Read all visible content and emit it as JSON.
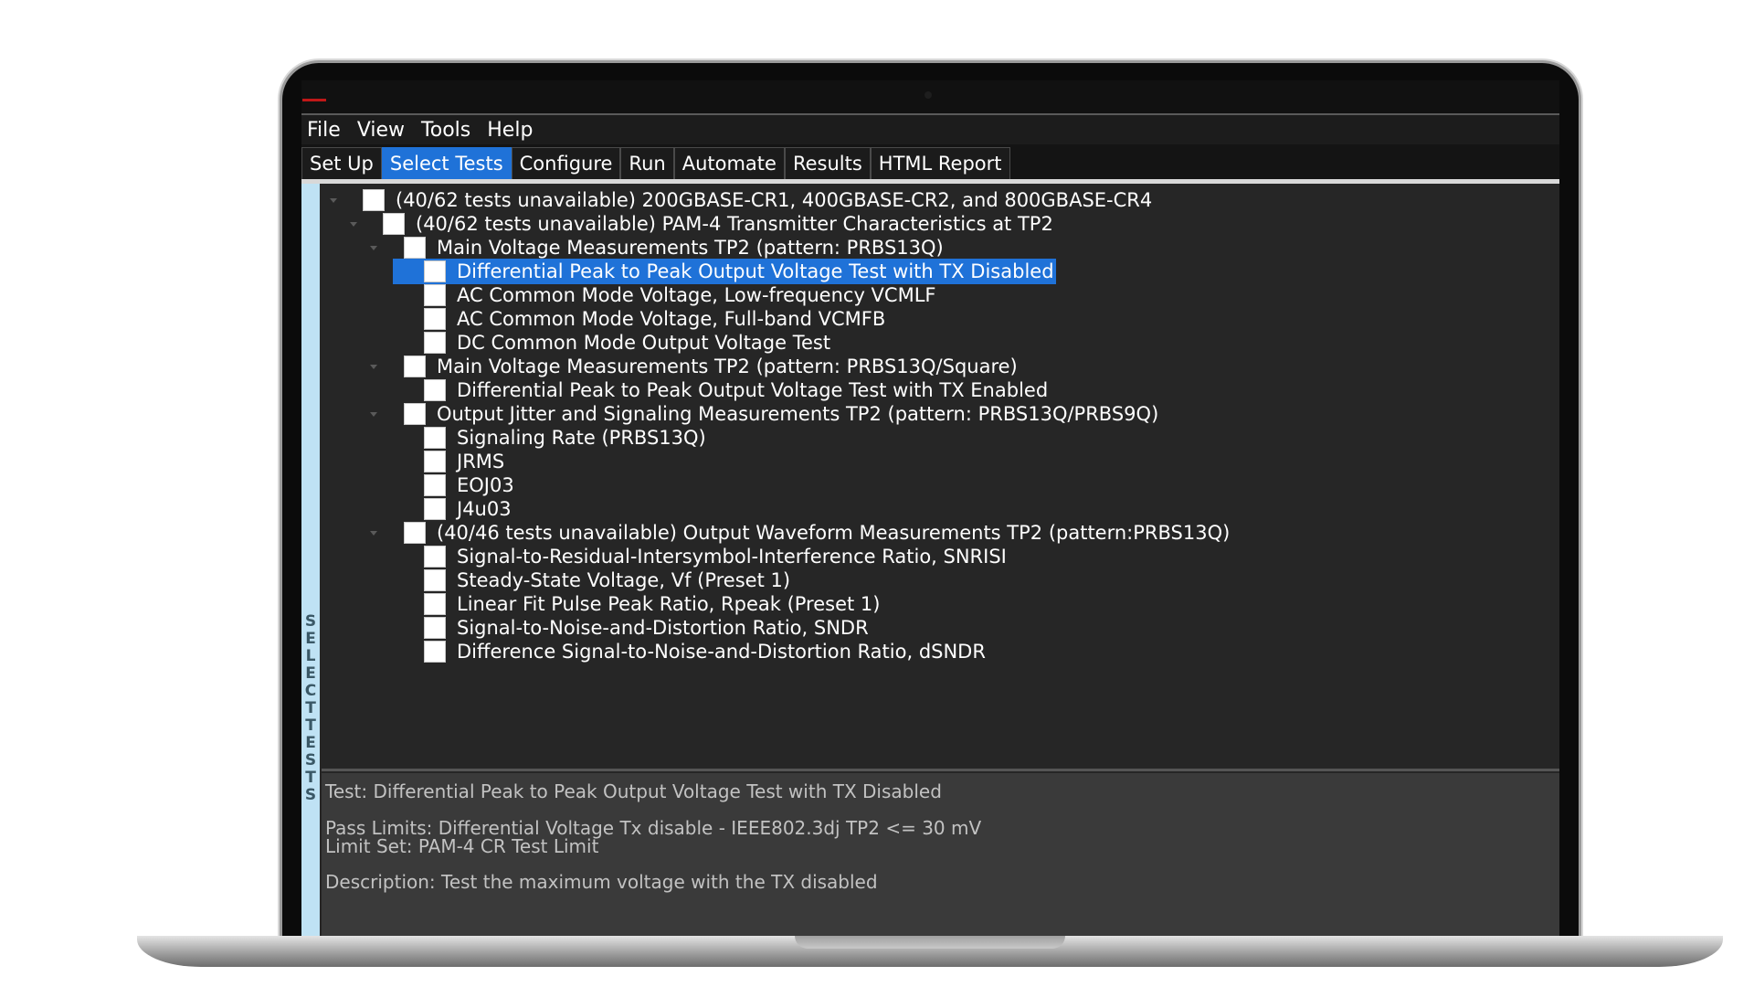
{
  "menu": [
    "File",
    "View",
    "Tools",
    "Help"
  ],
  "tabs": [
    {
      "label": "Set Up",
      "active": false
    },
    {
      "label": "Select Tests",
      "active": true
    },
    {
      "label": "Configure",
      "active": false
    },
    {
      "label": "Run",
      "active": false
    },
    {
      "label": "Automate",
      "active": false
    },
    {
      "label": "Results",
      "active": false
    },
    {
      "label": "HTML Report",
      "active": false
    }
  ],
  "side_panel": {
    "label": "SELECT TESTS"
  },
  "tree": [
    {
      "label": "(40/62 tests unavailable) 200GBASE-CR1, 400GBASE-CR2, and 800GBASE-CR4",
      "level": 0,
      "expandable": true,
      "checked": false,
      "selected": false
    },
    {
      "label": "(40/62 tests unavailable) PAM-4 Transmitter Characteristics at TP2",
      "level": 1,
      "expandable": true,
      "checked": false,
      "selected": false
    },
    {
      "label": "Main Voltage Measurements TP2 (pattern: PRBS13Q)",
      "level": 2,
      "expandable": true,
      "checked": false,
      "selected": false
    },
    {
      "label": "Differential Peak to Peak Output Voltage Test with TX Disabled",
      "level": 3,
      "expandable": false,
      "checked": false,
      "selected": true
    },
    {
      "label": "AC Common Mode Voltage, Low-frequency VCMLF",
      "level": 3,
      "expandable": false,
      "checked": false,
      "selected": false
    },
    {
      "label": "AC Common Mode Voltage, Full-band VCMFB",
      "level": 3,
      "expandable": false,
      "checked": false,
      "selected": false
    },
    {
      "label": "DC Common Mode Output Voltage Test",
      "level": 3,
      "expandable": false,
      "checked": false,
      "selected": false
    },
    {
      "label": "Main Voltage Measurements TP2 (pattern: PRBS13Q/Square)",
      "level": 2,
      "expandable": true,
      "checked": false,
      "selected": false
    },
    {
      "label": "Differential Peak to Peak Output Voltage Test with TX Enabled",
      "level": 3,
      "expandable": false,
      "checked": false,
      "selected": false
    },
    {
      "label": "Output Jitter and Signaling Measurements TP2 (pattern: PRBS13Q/PRBS9Q)",
      "level": 2,
      "expandable": true,
      "checked": false,
      "selected": false
    },
    {
      "label": "Signaling Rate (PRBS13Q)",
      "level": 3,
      "expandable": false,
      "checked": false,
      "selected": false
    },
    {
      "label": "JRMS",
      "level": 3,
      "expandable": false,
      "checked": false,
      "selected": false
    },
    {
      "label": "EOJ03",
      "level": 3,
      "expandable": false,
      "checked": false,
      "selected": false
    },
    {
      "label": "J4u03",
      "level": 3,
      "expandable": false,
      "checked": false,
      "selected": false
    },
    {
      "label": "(40/46 tests unavailable) Output Waveform Measurements TP2 (pattern:PRBS13Q)",
      "level": 2,
      "expandable": true,
      "checked": false,
      "selected": false
    },
    {
      "label": "Signal-to-Residual-Intersymbol-Interference Ratio, SNRISI",
      "level": 3,
      "expandable": false,
      "checked": false,
      "selected": false
    },
    {
      "label": "Steady-State Voltage, Vf (Preset 1)",
      "level": 3,
      "expandable": false,
      "checked": false,
      "selected": false
    },
    {
      "label": "Linear Fit Pulse Peak Ratio, Rpeak (Preset 1)",
      "level": 3,
      "expandable": false,
      "checked": false,
      "selected": false
    },
    {
      "label": "Signal-to-Noise-and-Distortion Ratio, SNDR",
      "level": 3,
      "expandable": false,
      "checked": false,
      "selected": false
    },
    {
      "label": "Difference Signal-to-Noise-and-Distortion Ratio, dSNDR",
      "level": 3,
      "expandable": false,
      "checked": false,
      "selected": false
    }
  ],
  "details": {
    "test": "Test: Differential Peak to Peak Output Voltage Test with TX Disabled",
    "pass_limits": "Pass Limits: Differential Voltage Tx disable - IEEE802.3dj TP2 <= 30 mV",
    "limit_set": "Limit Set: PAM-4 CR Test Limit",
    "description": "Description: Test the maximum voltage with the TX disabled"
  },
  "colors": {
    "accent": "#1f72d8",
    "background": "#262626",
    "side_panel": "#bfe2f4",
    "details_bg": "#3a3a3a"
  }
}
